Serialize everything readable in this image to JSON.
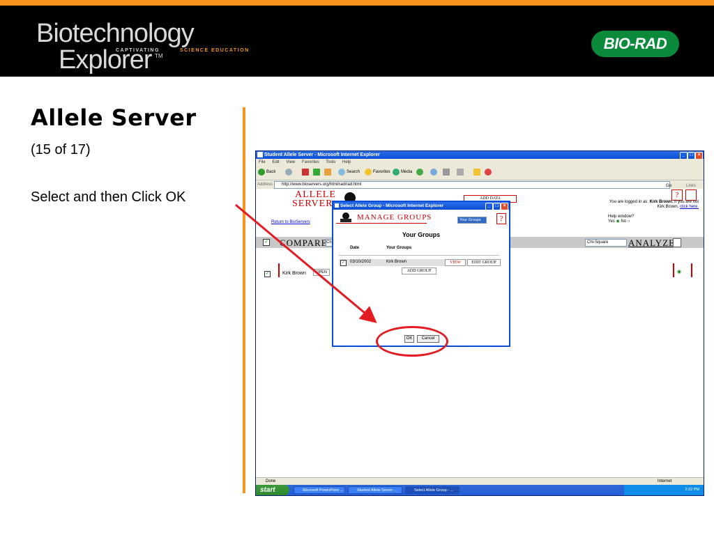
{
  "slide": {
    "logo_line1": "Biotechnology",
    "logo_line2": "Explorer",
    "logo_tm": "TM",
    "logo_captivating": "CAPTIVATING",
    "logo_science": "SCIENCE EDUCATION",
    "biorad": "BIO-RAD",
    "title": "Allele Server",
    "subtitle": "(15 of 17)",
    "instruction": "Select and then Click OK"
  },
  "ie": {
    "title": "Student Allele Server - Microsoft Internet Explorer",
    "menu": [
      "File",
      "Edit",
      "View",
      "Favorites",
      "Tools",
      "Help"
    ],
    "toolbar": {
      "back": "Back",
      "search": "Search",
      "favorites": "Favorites",
      "media": "Media"
    },
    "address_label": "Address",
    "address": "http://www.bioservers.org/html/rad/rad.html",
    "go": "Go",
    "links": "Links",
    "status": "Done",
    "zone": "Internet"
  },
  "page": {
    "logo1": "ALLELE",
    "logo2": "SERVER",
    "add_data": "ADD DATA",
    "return_link": "Return to BioServers",
    "logged_in_prefix": "You are logged in as:",
    "logged_in_user": "Kirk Brown.",
    "logged_in_suffix": "If you are not Kirk Brown,",
    "logged_in_link": "click here.",
    "help_window": "Help window?",
    "yes": "Yes",
    "no": "No",
    "compare": "COMPARE",
    "compare_select": "Chi",
    "chi_select": "Chi-Square",
    "analyze": "ANALYZE",
    "kirk": "Kirk Brown",
    "open": "OPEN"
  },
  "dialog": {
    "title": "Select Allele Group - Microsoft Internet Explorer",
    "manage_groups": "MANAGE GROUPS",
    "groups_select": "Your Groups",
    "help": "?",
    "heading": "Your Groups",
    "col_date": "Date",
    "col_groups": "Your Groups",
    "rows": [
      {
        "date": "03/10/2002",
        "name": "Kirk Brown"
      }
    ],
    "view": "VIEW",
    "edit_group": "EDIT GROUP",
    "add_group": "ADD GROUP",
    "ok": "OK",
    "cancel": "Cancel"
  },
  "taskbar": {
    "start": "start",
    "tasks": [
      "Microsoft PowerPoint ...",
      "Student Allele Server ...",
      "Select Allele Group - ..."
    ],
    "time": "2:22 PM"
  },
  "colors": {
    "accent": "#f7941d",
    "annotation": "#e31b23",
    "xp_blue": "#0b4cd4"
  }
}
